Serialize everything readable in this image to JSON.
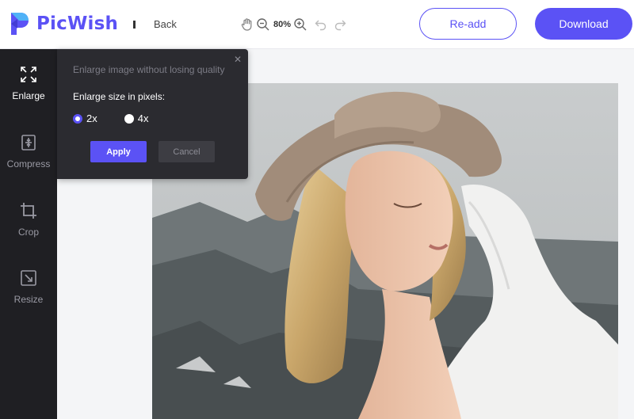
{
  "header": {
    "brand": "PicWish",
    "back_label": "Back",
    "zoom_value": "80%",
    "readd_label": "Re-add",
    "download_label": "Download",
    "tool_icons": [
      "hand-icon",
      "zoom-out-icon",
      "zoom-in-icon",
      "undo-icon",
      "redo-icon"
    ]
  },
  "sidebar": {
    "items": [
      {
        "label": "Enlarge",
        "icon": "enlarge-icon",
        "active": true
      },
      {
        "label": "Compress",
        "icon": "compress-icon",
        "active": false
      },
      {
        "label": "Crop",
        "icon": "crop-icon",
        "active": false
      },
      {
        "label": "Resize",
        "icon": "resize-icon",
        "active": false
      }
    ]
  },
  "popover": {
    "hint": "Enlarge image without losing quality",
    "label": "Enlarge size in pixels:",
    "options": [
      {
        "label": "2x",
        "checked": true
      },
      {
        "label": "4x",
        "checked": false
      }
    ],
    "apply_label": "Apply",
    "cancel_label": "Cancel",
    "close_glyph": "✕"
  },
  "colors": {
    "accent": "#5b52f5",
    "sidebar_bg": "#1f1f23",
    "popover_bg": "#2b2b30"
  }
}
